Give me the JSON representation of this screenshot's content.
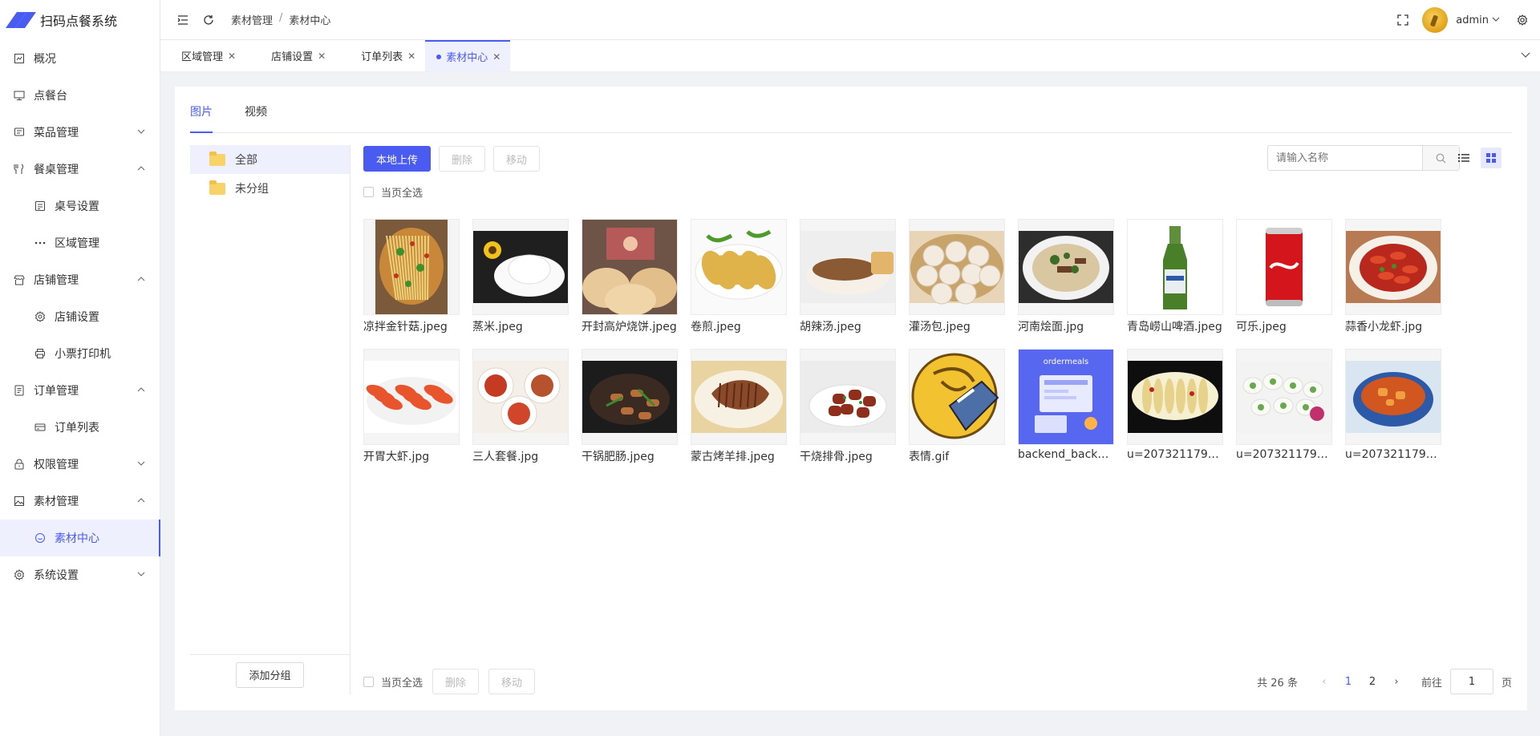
{
  "app": {
    "title": "扫码点餐系统",
    "accent": "#4a5bf2"
  },
  "sidebar": {
    "items": [
      {
        "label": "概况",
        "icon": "dashboard-icon",
        "level": 1
      },
      {
        "label": "点餐台",
        "icon": "monitor-icon",
        "level": 1
      },
      {
        "label": "菜品管理",
        "icon": "dish-icon",
        "level": 1,
        "chevron": "down"
      },
      {
        "label": "餐桌管理",
        "icon": "fork-knife-icon",
        "level": 1,
        "chevron": "up"
      },
      {
        "label": "桌号设置",
        "icon": "table-number-icon",
        "level": 2
      },
      {
        "label": "区域管理",
        "icon": "more-dots-icon",
        "level": 2
      },
      {
        "label": "店铺管理",
        "icon": "store-icon",
        "level": 1,
        "chevron": "up"
      },
      {
        "label": "店铺设置",
        "icon": "gear-icon",
        "level": 2
      },
      {
        "label": "小票打印机",
        "icon": "printer-icon",
        "level": 2
      },
      {
        "label": "订单管理",
        "icon": "order-icon",
        "level": 1,
        "chevron": "up"
      },
      {
        "label": "订单列表",
        "icon": "card-icon",
        "level": 2
      },
      {
        "label": "权限管理",
        "icon": "lock-icon",
        "level": 1,
        "chevron": "down"
      },
      {
        "label": "素材管理",
        "icon": "image-icon",
        "level": 1,
        "chevron": "up"
      },
      {
        "label": "素材中心",
        "icon": "palette-icon",
        "level": 2,
        "active": true
      },
      {
        "label": "系统设置",
        "icon": "settings-icon",
        "level": 1,
        "chevron": "down"
      }
    ]
  },
  "header": {
    "breadcrumb": [
      "素材管理",
      "/",
      "素材中心"
    ],
    "user": "admin"
  },
  "viewtabs": [
    {
      "label": "区域管理",
      "active": false
    },
    {
      "label": "店铺设置",
      "active": false
    },
    {
      "label": "订单列表",
      "active": false
    },
    {
      "label": "素材中心",
      "active": true
    }
  ],
  "content_tabs": [
    {
      "label": "图片",
      "active": true
    },
    {
      "label": "视频",
      "active": false
    }
  ],
  "groups": {
    "items": [
      {
        "label": "全部",
        "active": true
      },
      {
        "label": "未分组",
        "active": false
      }
    ],
    "add_label": "添加分组"
  },
  "toolbar": {
    "upload": "本地上传",
    "delete": "删除",
    "move": "移动",
    "search_placeholder": "请输入名称",
    "select_all": "当页全选"
  },
  "files": [
    {
      "name": "凉拌金针菇.jpeg",
      "art": "salad"
    },
    {
      "name": "蒸米.jpeg",
      "art": "rice"
    },
    {
      "name": "开封高炉烧饼.jpeg",
      "art": "flatbread"
    },
    {
      "name": "卷煎.jpeg",
      "art": "pancake"
    },
    {
      "name": "胡辣汤.jpeg",
      "art": "soup"
    },
    {
      "name": "灌汤包.jpeg",
      "art": "dumpling"
    },
    {
      "name": "河南烩面.jpg",
      "art": "noodle"
    },
    {
      "name": "青岛崂山啤酒.jpeg",
      "art": "beer"
    },
    {
      "name": "可乐.jpeg",
      "art": "cola"
    },
    {
      "name": "蒜香小龙虾.jpg",
      "art": "crayfish"
    },
    {
      "name": "开胃大虾.jpg",
      "art": "shrimp"
    },
    {
      "name": "三人套餐.jpg",
      "art": "combo"
    },
    {
      "name": "干锅肥肠.jpeg",
      "art": "drypot"
    },
    {
      "name": "蒙古烤羊排.jpeg",
      "art": "lamb"
    },
    {
      "name": "干烧排骨.jpeg",
      "art": "ribs"
    },
    {
      "name": "表情.gif",
      "art": "emoji"
    },
    {
      "name": "backend_backdr...",
      "art": "banner",
      "banner_text": "ordermeals"
    },
    {
      "name": "u=2073211799,...",
      "art": "fishplate"
    },
    {
      "name": "u=2073211799,...",
      "art": "rolls"
    },
    {
      "name": "u=2073211799,...",
      "art": "stew"
    }
  ],
  "footer": {
    "select_all": "当页全选",
    "delete": "删除",
    "move": "移动",
    "total": "共 26 条",
    "pages": [
      "1",
      "2"
    ],
    "current_page": "1",
    "goto_label": "前往",
    "goto_value": "1",
    "page_suffix": "页"
  }
}
